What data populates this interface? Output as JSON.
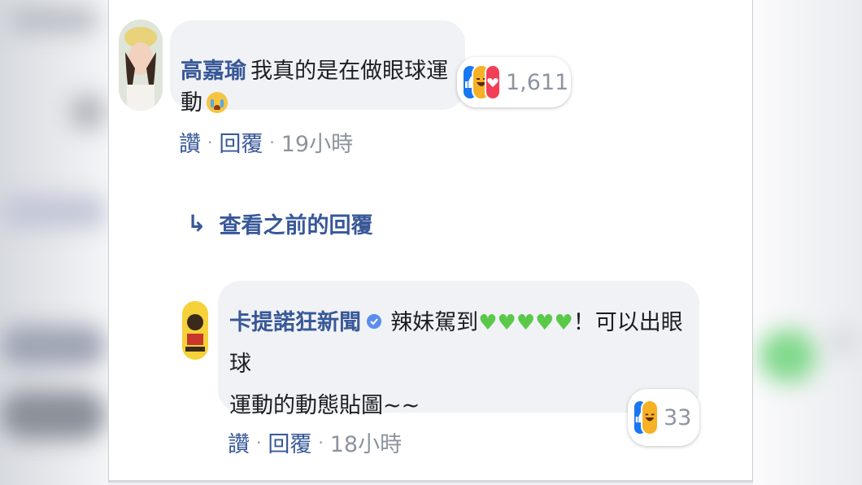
{
  "comment1": {
    "author": "高嘉瑜",
    "text": "我真的是在做眼球運動",
    "reaction_count": "1,611",
    "reactions": [
      "like-icon",
      "haha-icon",
      "love-icon"
    ],
    "actions": {
      "like": "讚",
      "reply": "回覆",
      "time": "19小時"
    }
  },
  "view_previous": {
    "arrow": "↳",
    "label": "查看之前的回覆"
  },
  "comment2": {
    "author": "卡提諾狂新聞",
    "text_part1": "辣妹駕到",
    "hearts": [
      "💚",
      "💚",
      "💚",
      "💚",
      "💚"
    ],
    "text_part2": "！可以出眼球",
    "text_line2": "運動的動態貼圖~~",
    "reaction_count": "33",
    "reactions": [
      "like-icon",
      "haha-icon"
    ],
    "actions": {
      "like": "讚",
      "reply": "回覆",
      "time": "18小時"
    }
  },
  "colors": {
    "name": "#385898",
    "bubble": "#f0f2f5",
    "like": "#1877f2",
    "haha": "#f7b125",
    "love": "#f33e58",
    "verified": "#5b8def",
    "heart": "#5ac94a"
  }
}
